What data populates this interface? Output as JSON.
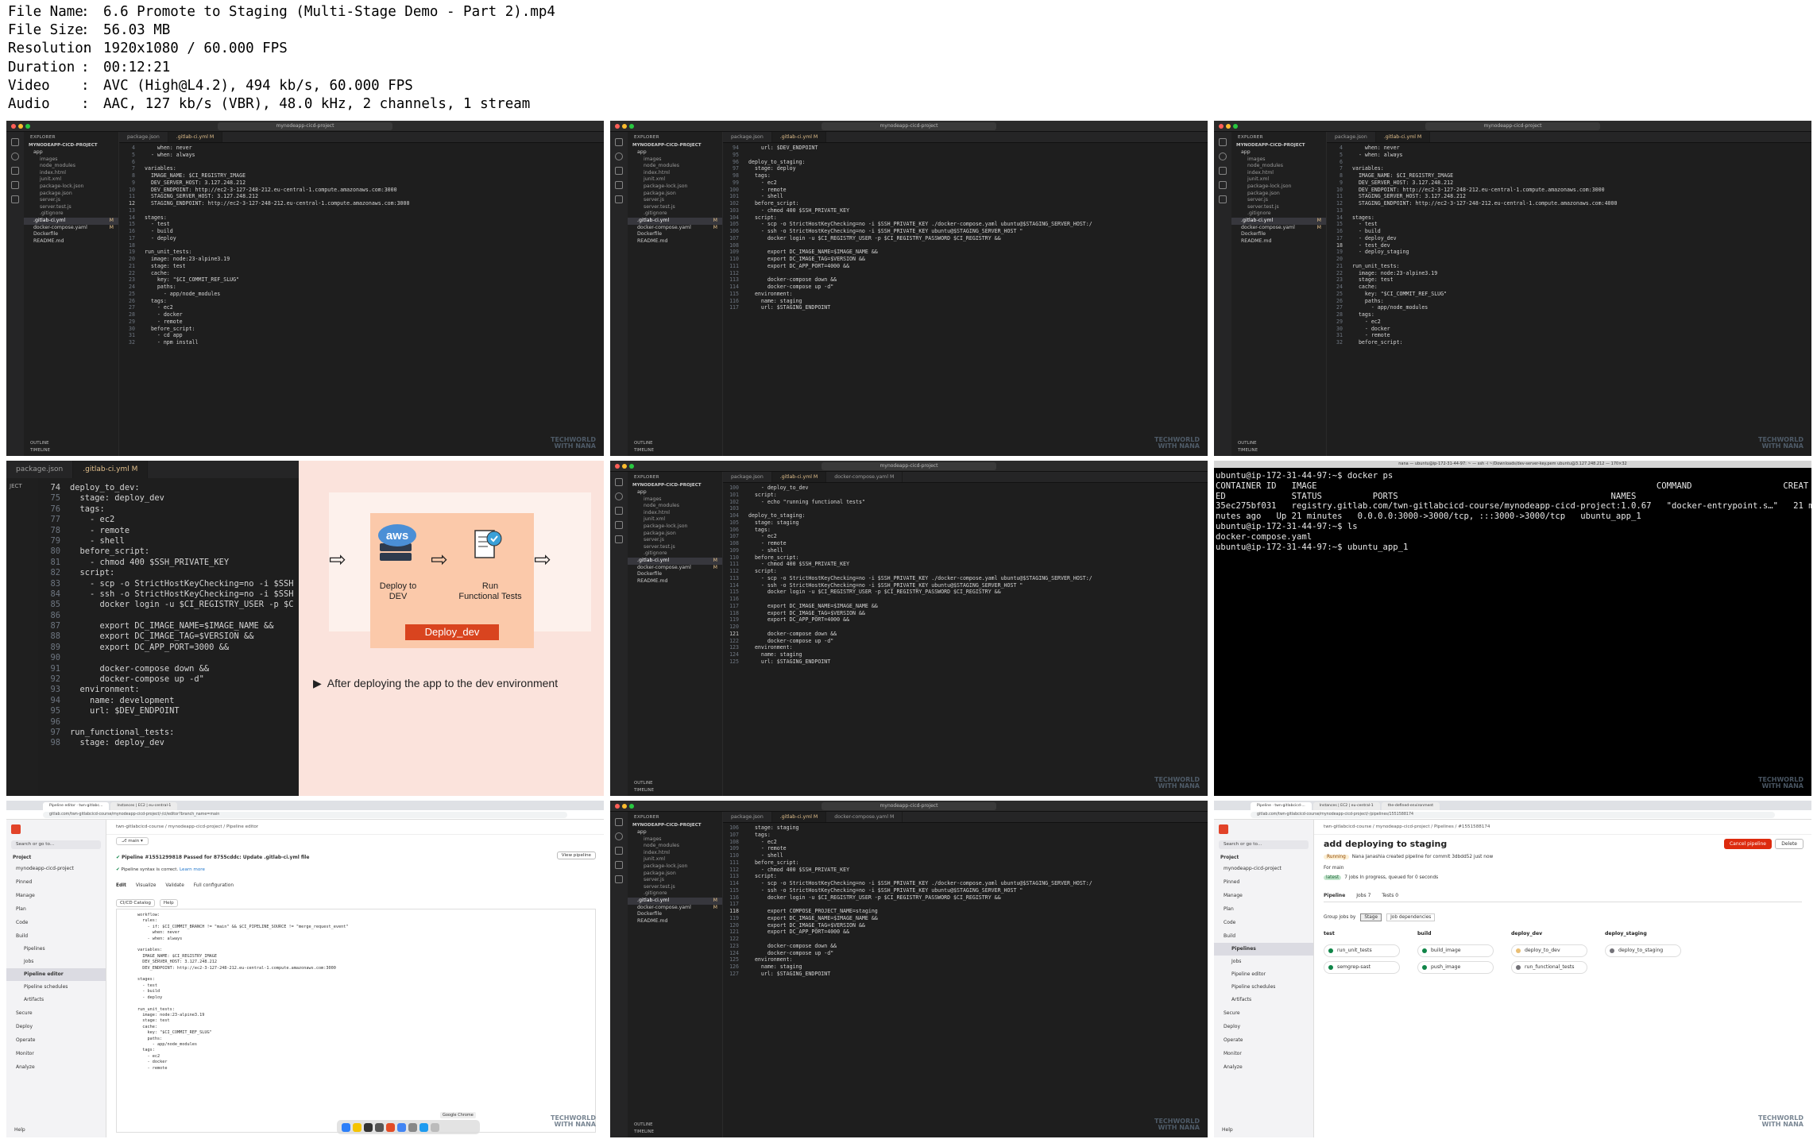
{
  "info": [
    {
      "key": "File Name",
      "value": "6.6 Promote to Staging (Multi-Stage Demo - Part 2).mp4"
    },
    {
      "key": "File Size",
      "value": "56.03 MB"
    },
    {
      "key": "Resolution",
      "value": "1920x1080 / 60.000 FPS"
    },
    {
      "key": "Duration",
      "value": "00:12:21"
    },
    {
      "key": "Video",
      "value": "AVC (High@L4.2), 494 kb/s, 60.000 FPS"
    },
    {
      "key": "Audio",
      "value": "AAC, 127 kb/s (VBR), 48.0 kHz, 2 channels, 1 stream"
    }
  ],
  "vscode": {
    "search": "mynodeapp-cicd-project",
    "explorer_label": "EXPLORER",
    "project": "MYNODEAPP-CICD-PROJECT",
    "files": [
      "app",
      "images",
      "node_modules",
      "index.html",
      "junit.xml",
      "package-lock.json",
      "package.json",
      "server.js",
      "server.test.js",
      ".gitignore",
      ".gitlab-ci.yml",
      "docker-compose.yaml",
      "Dockerfile",
      "README.md"
    ],
    "outline": "OUTLINE",
    "timeline": "TIMELINE",
    "tab_pkg": "package.json",
    "tab_ci": ".gitlab-ci.yml M",
    "tab_dc": "docker-compose.yaml M",
    "watermark_1": "TECHWORLD",
    "watermark_2": "WITH NANA"
  },
  "t1_code": [
    [
      "4",
      "    when: never"
    ],
    [
      "5",
      "  - when: always"
    ],
    [
      "6",
      ""
    ],
    [
      "7",
      "variables:"
    ],
    [
      "8",
      "  IMAGE_NAME: $CI_REGISTRY_IMAGE"
    ],
    [
      "9",
      "  DEV_SERVER_HOST: 3.127.248.212"
    ],
    [
      "10",
      "  DEV_ENDPOINT: http://ec2-3-127-248-212.eu-central-1.compute.amazonaws.com:3000"
    ],
    [
      "11",
      "  STAGING_SERVER_HOST: 3.127.248.212"
    ],
    [
      "12",
      "  STAGING_ENDPOINT: http://ec2-3-127-248-212.eu-central-1.compute.amazonaws.com:3000"
    ],
    [
      "13",
      ""
    ],
    [
      "14",
      "stages:"
    ],
    [
      "15",
      "  - test"
    ],
    [
      "16",
      "  - build"
    ],
    [
      "17",
      "  - deploy"
    ],
    [
      "18",
      ""
    ],
    [
      "19",
      "run_unit_tests:"
    ],
    [
      "20",
      "  image: node:23-alpine3.19"
    ],
    [
      "21",
      "  stage: test"
    ],
    [
      "22",
      "  cache:"
    ],
    [
      "23",
      "    key: \"$CI_COMMIT_REF_SLUG\""
    ],
    [
      "24",
      "    paths:"
    ],
    [
      "25",
      "      - app/node_modules"
    ],
    [
      "26",
      "  tags:"
    ],
    [
      "27",
      "    - ec2"
    ],
    [
      "28",
      "    - docker"
    ],
    [
      "29",
      "    - remote"
    ],
    [
      "30",
      "  before_script:"
    ],
    [
      "31",
      "    - cd app"
    ],
    [
      "32",
      "    - npm install"
    ]
  ],
  "t2_code": [
    [
      "94",
      "    url: $DEV_ENDPOINT"
    ],
    [
      "95",
      ""
    ],
    [
      "96",
      "deploy_to_staging:"
    ],
    [
      "97",
      "  stage: deploy"
    ],
    [
      "98",
      "  tags:"
    ],
    [
      "99",
      "    - ec2"
    ],
    [
      "100",
      "    - remote"
    ],
    [
      "101",
      "    - shell"
    ],
    [
      "102",
      "  before_script:"
    ],
    [
      "103",
      "    - chmod 400 $SSH_PRIVATE_KEY"
    ],
    [
      "104",
      "  script:"
    ],
    [
      "105",
      "    - scp -o StrictHostKeyChecking=no -i $SSH_PRIVATE_KEY ./docker-compose.yaml ubuntu@$STAGING_SERVER_HOST:/"
    ],
    [
      "106",
      "    - ssh -o StrictHostKeyChecking=no -i $SSH_PRIVATE_KEY ubuntu@$STAGING_SERVER_HOST \""
    ],
    [
      "107",
      "      docker login -u $CI_REGISTRY_USER -p $CI_REGISTRY_PASSWORD $CI_REGISTRY &&"
    ],
    [
      "108",
      ""
    ],
    [
      "109",
      "      export DC_IMAGE_NAME=$IMAGE_NAME &&"
    ],
    [
      "110",
      "      export DC_IMAGE_TAG=$VERSION &&"
    ],
    [
      "111",
      "      export DC_APP_PORT=4000 &&"
    ],
    [
      "112",
      ""
    ],
    [
      "113",
      "      docker-compose down &&"
    ],
    [
      "114",
      "      docker-compose up -d\""
    ],
    [
      "115",
      "  environment:"
    ],
    [
      "116",
      "    name: staging"
    ],
    [
      "117",
      "    url: $STAGING_ENDPOINT"
    ]
  ],
  "t3_code": [
    [
      "4",
      "    when: never"
    ],
    [
      "5",
      "  - when: always"
    ],
    [
      "6",
      ""
    ],
    [
      "7",
      "variables:"
    ],
    [
      "8",
      "  IMAGE_NAME: $CI_REGISTRY_IMAGE"
    ],
    [
      "9",
      "  DEV_SERVER_HOST: 3.127.248.212"
    ],
    [
      "10",
      "  DEV_ENDPOINT: http://ec2-3-127-248-212.eu-central-1.compute.amazonaws.com:3000"
    ],
    [
      "11",
      "  STAGING_SERVER_HOST: 3.127.248.212"
    ],
    [
      "12",
      "  STAGING_ENDPOINT: http://ec2-3-127-248-212.eu-central-1.compute.amazonaws.com:4000"
    ],
    [
      "13",
      ""
    ],
    [
      "14",
      "stages:"
    ],
    [
      "15",
      "  - test"
    ],
    [
      "16",
      "  - build"
    ],
    [
      "17",
      "  - deploy_dev"
    ],
    [
      "18",
      "  - test_dev"
    ],
    [
      "19",
      "  - deploy_staging"
    ],
    [
      "20",
      ""
    ],
    [
      "21",
      "run_unit_tests:"
    ],
    [
      "22",
      "  image: node:23-alpine3.19"
    ],
    [
      "23",
      "  stage: test"
    ],
    [
      "24",
      "  cache:"
    ],
    [
      "25",
      "    key: \"$CI_COMMIT_REF_SLUG\""
    ],
    [
      "26",
      "    paths:"
    ],
    [
      "27",
      "      - app/node_modules"
    ],
    [
      "28",
      "  tags:"
    ],
    [
      "29",
      "    - ec2"
    ],
    [
      "30",
      "    - docker"
    ],
    [
      "31",
      "    - remote"
    ],
    [
      "32",
      "  before_script:"
    ]
  ],
  "t4_code": [
    [
      "74",
      "deploy_to_dev:"
    ],
    [
      "75",
      "  stage: deploy_dev"
    ],
    [
      "76",
      "  tags:"
    ],
    [
      "77",
      "    - ec2"
    ],
    [
      "78",
      "    - remote"
    ],
    [
      "79",
      "    - shell"
    ],
    [
      "80",
      "  before_script:"
    ],
    [
      "81",
      "    - chmod 400 $SSH_PRIVATE_KEY"
    ],
    [
      "82",
      "  script:"
    ],
    [
      "83",
      "    - scp -o StrictHostKeyChecking=no -i $SSH"
    ],
    [
      "84",
      "    - ssh -o StrictHostKeyChecking=no -i $SSH"
    ],
    [
      "85",
      "      docker login -u $CI_REGISTRY_USER -p $C"
    ],
    [
      "86",
      ""
    ],
    [
      "87",
      "      export DC_IMAGE_NAME=$IMAGE_NAME &&"
    ],
    [
      "88",
      "      export DC_IMAGE_TAG=$VERSION &&"
    ],
    [
      "89",
      "      export DC_APP_PORT=3000 &&"
    ],
    [
      "90",
      ""
    ],
    [
      "91",
      "      docker-compose down &&"
    ],
    [
      "92",
      "      docker-compose up -d\""
    ],
    [
      "93",
      "  environment:"
    ],
    [
      "94",
      "    name: development"
    ],
    [
      "95",
      "    url: $DEV_ENDPOINT"
    ],
    [
      "96",
      ""
    ],
    [
      "97",
      "run_functional_tests:"
    ],
    [
      "98",
      "  stage: deploy_dev"
    ]
  ],
  "t4_slide": {
    "tab_pkg": "package.json",
    "tab_ci": ".gitlab-ci.yml M",
    "side_label": "JECT",
    "deploy_label": "Deploy to\nDEV",
    "run_label": "Run\nFunctional Tests",
    "badge": "Deploy_dev",
    "caption": "After deploying the app to the dev environment",
    "aws": "aws"
  },
  "t5_code": [
    [
      "100",
      "    - deploy_to_dev"
    ],
    [
      "101",
      "  script:"
    ],
    [
      "102",
      "    - echo \"running functional tests\""
    ],
    [
      "103",
      ""
    ],
    [
      "104",
      "deploy_to_staging:"
    ],
    [
      "105",
      "  stage: staging"
    ],
    [
      "106",
      "  tags:"
    ],
    [
      "107",
      "    - ec2"
    ],
    [
      "108",
      "    - remote"
    ],
    [
      "109",
      "    - shell"
    ],
    [
      "110",
      "  before_script:"
    ],
    [
      "111",
      "    - chmod 400 $SSH_PRIVATE_KEY"
    ],
    [
      "112",
      "  script:"
    ],
    [
      "113",
      "    - scp -o StrictHostKeyChecking=no -i $SSH_PRIVATE_KEY ./docker-compose.yaml ubuntu@$STAGING_SERVER_HOST:/"
    ],
    [
      "114",
      "    - ssh -o StrictHostKeyChecking=no -i $SSH_PRIVATE_KEY ubuntu@$STAGING_SERVER_HOST \""
    ],
    [
      "115",
      "      docker login -u $CI_REGISTRY_USER -p $CI_REGISTRY_PASSWORD $CI_REGISTRY &&"
    ],
    [
      "116",
      ""
    ],
    [
      "117",
      "      export DC_IMAGE_NAME=$IMAGE_NAME &&"
    ],
    [
      "118",
      "      export DC_IMAGE_TAG=$VERSION &&"
    ],
    [
      "119",
      "      export DC_APP_PORT=4000 &&"
    ],
    [
      "120",
      ""
    ],
    [
      "121",
      "      docker-compose down &&"
    ],
    [
      "122",
      "      docker-compose up -d\""
    ],
    [
      "123",
      "  environment:"
    ],
    [
      "124",
      "    name: staging"
    ],
    [
      "125",
      "    url: $STAGING_ENDPOINT"
    ]
  ],
  "terminal": {
    "title": "nana — ubuntu@ip-172-31-44-97: ~ — ssh -i ~/Downloads/dev-server-key.pem ubuntu@3.127.248.212 — 170×32",
    "lines": [
      "ubuntu@ip-172-31-44-97:~$ docker ps",
      "CONTAINER ID   IMAGE                                                                   COMMAND                  CREAT",
      "ED             STATUS          PORTS                                          NAMES",
      "35ec275bf031   registry.gitlab.com/twn-gitlabcicd-course/mynodeapp-cicd-project:1.0.67   \"docker-entrypoint.s…\"   21 mi",
      "nutes ago   Up 21 minutes   0.0.0.0:3000->3000/tcp, :::3000->3000/tcp   ubuntu_app_1",
      "ubuntu@ip-172-31-44-97:~$ ls",
      "docker-compose.yaml",
      "ubuntu@ip-172-31-44-97:~$ ubuntu_app_1"
    ]
  },
  "t7": {
    "tabs": [
      "Pipeline editor · twn-gitlabc...",
      "Instances | EC2 | eu-central-1"
    ],
    "url": "gitlab.com/twn-gitlabcicd-course/mynodeapp-cicd-project/-/ci/editor?branch_name=main",
    "search": "Search or go to...",
    "project_label": "Project",
    "nav": [
      "mynodeapp-cicd-project",
      "Pinned",
      "Manage",
      "Plan",
      "Code",
      "Build",
      "Pipelines",
      "Jobs",
      "Pipeline editor",
      "Pipeline schedules",
      "Artifacts",
      "Secure",
      "Deploy",
      "Operate",
      "Monitor",
      "Analyze"
    ],
    "help": "Help",
    "crumb": "twn-gitlabcicd-course / mynodeapp-cicd-project / Pipeline editor",
    "branch": "main",
    "pipeline_status": "Pipeline #1551299818 Passed for 8755cddc: Update .gitlab-ci.yml file",
    "view_pipeline": "View pipeline",
    "syntax": "Pipeline syntax is correct.",
    "learn_more": "Learn more",
    "editor_tabs": [
      "Edit",
      "Visualize",
      "Validate",
      "Full configuration"
    ],
    "catalog": "CI/CD Catalog",
    "help_btn": "Help",
    "code": "workflow:\n  rules:\n    - if: $CI_COMMIT_BRANCH != \"main\" && $CI_PIPELINE_SOURCE != \"merge_request_event\"\n      when: never\n    - when: always\n\nvariables:\n  IMAGE_NAME: $CI_REGISTRY_IMAGE\n  DEV_SERVER_HOST: 3.127.248.212\n  DEV_ENDPOINT: http://ec2-3-127-248-212.eu-central-1.compute.amazonaws.com:3000\n\nstages:\n  - test\n  - build\n  - deploy\n\nrun_unit_tests:\n  image: node:23-alpine3.19\n  stage: test\n  cache:\n    key: \"$CI_COMMIT_REF_SLUG\"\n    paths:\n      - app/node_modules\n  tags:\n    - ec2\n    - docker\n    - remote",
    "dock_tip": "Google Chrome"
  },
  "t8_code": [
    [
      "106",
      "  stage: staging"
    ],
    [
      "107",
      "  tags:"
    ],
    [
      "108",
      "    - ec2"
    ],
    [
      "109",
      "    - remote"
    ],
    [
      "110",
      "    - shell"
    ],
    [
      "111",
      "  before_script:"
    ],
    [
      "112",
      "    - chmod 400 $SSH_PRIVATE_KEY"
    ],
    [
      "113",
      "  script:"
    ],
    [
      "114",
      "    - scp -o StrictHostKeyChecking=no -i $SSH_PRIVATE_KEY ./docker-compose.yaml ubuntu@$STAGING_SERVER_HOST:/"
    ],
    [
      "115",
      "    - ssh -o StrictHostKeyChecking=no -i $SSH_PRIVATE_KEY ubuntu@$STAGING_SERVER_HOST \""
    ],
    [
      "116",
      "      docker login -u $CI_REGISTRY_USER -p $CI_REGISTRY_PASSWORD $CI_REGISTRY &&"
    ],
    [
      "117",
      ""
    ],
    [
      "118",
      "      export COMPOSE_PROJECT_NAME=staging"
    ],
    [
      "119",
      "      export DC_IMAGE_NAME=$IMAGE_NAME &&"
    ],
    [
      "120",
      "      export DC_IMAGE_TAG=$VERSION &&"
    ],
    [
      "121",
      "      export DC_APP_PORT=4000 &&"
    ],
    [
      "122",
      ""
    ],
    [
      "123",
      "      docker-compose down &&"
    ],
    [
      "124",
      "      docker-compose up -d\""
    ],
    [
      "125",
      "  environment:"
    ],
    [
      "126",
      "    name: staging"
    ],
    [
      "127",
      "    url: $STAGING_ENDPOINT"
    ]
  ],
  "t9": {
    "tabs": [
      "Pipeline · twn-gitlabcicd-...",
      "Instances | EC2 | eu-central-1",
      "the-defined-environment"
    ],
    "url": "gitlab.com/twn-gitlabcicd-course/mynodeapp-cicd-project/-/pipelines/1551588174",
    "crumb": "twn-gitlabcicd-course / mynodeapp-cicd-project / Pipelines / #1551588174",
    "title": "add deploying to staging",
    "running": "Running",
    "meta": "Nana Janashia created pipeline for commit 3dbdd52 just now",
    "for": "For main",
    "latest": "latest",
    "jobs_info": "7 jobs  In progress, queued for 0 seconds",
    "cancel": "Cancel pipeline",
    "delete": "Delete",
    "ptabs": [
      "Pipeline",
      "Jobs 7",
      "Tests 0"
    ],
    "group_by": "Group jobs by",
    "stage_btn": "Stage",
    "dep_btn": "Job dependencies",
    "stages": [
      {
        "name": "test",
        "jobs": [
          "run_unit_tests",
          "semgrep-sast"
        ],
        "status": "passed"
      },
      {
        "name": "build",
        "jobs": [
          "build_image",
          "push_image"
        ],
        "status": "passed"
      },
      {
        "name": "deploy_dev",
        "jobs": [
          "deploy_to_dev",
          "run_functional_tests"
        ],
        "status": "running"
      },
      {
        "name": "deploy_staging",
        "jobs": [
          "deploy_to_staging"
        ],
        "status": "created"
      }
    ]
  },
  "colors": {
    "passed": "#108548",
    "running": "#e9be74",
    "created": "#737278",
    "accent": "#e24329"
  }
}
